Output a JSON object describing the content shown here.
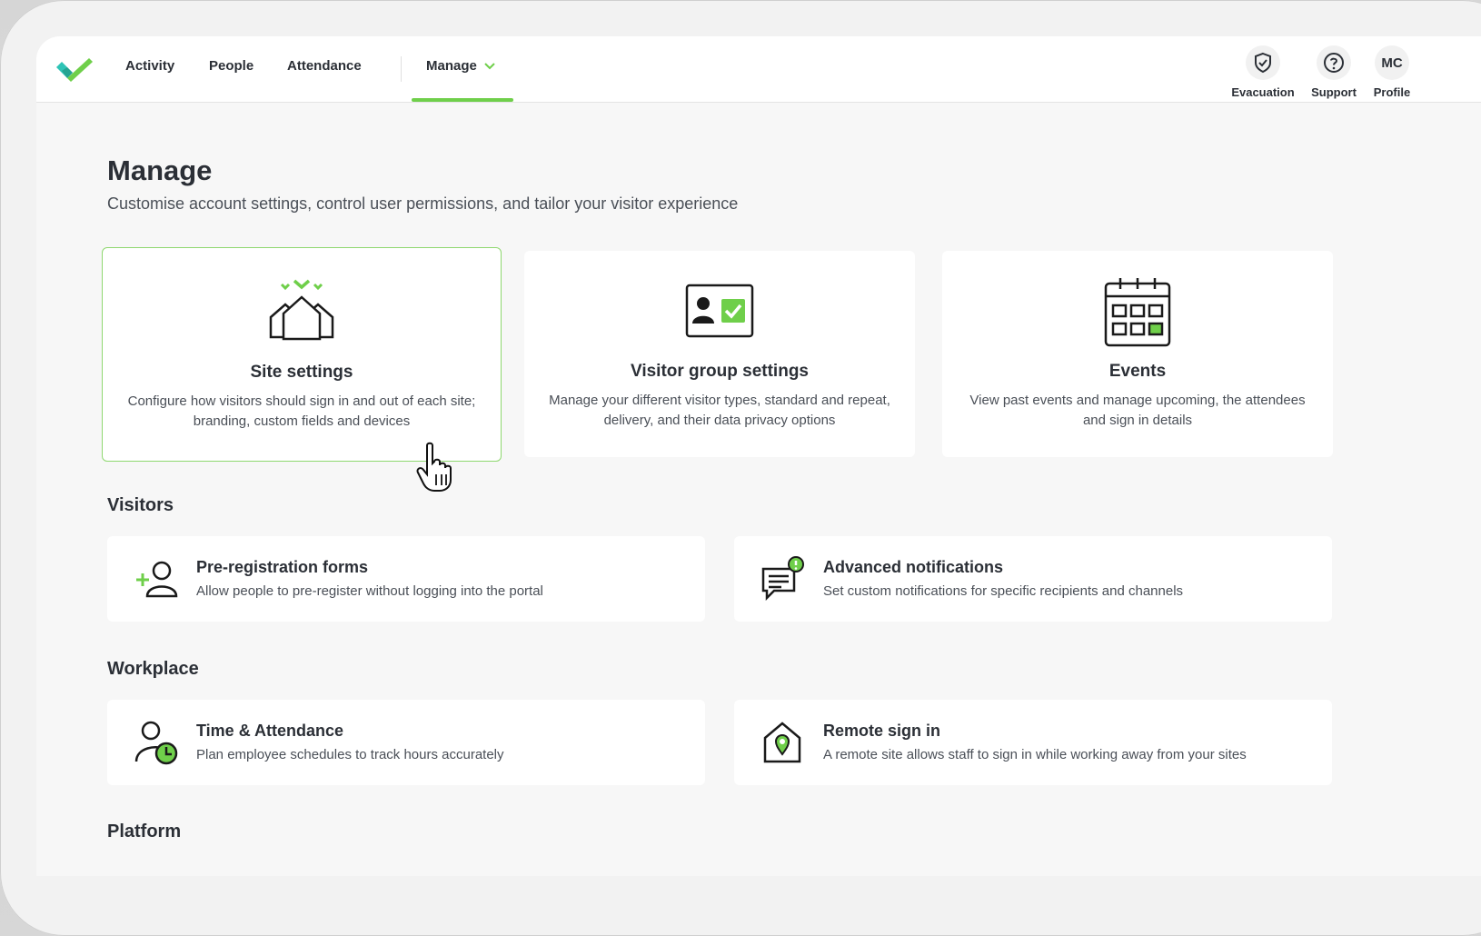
{
  "nav": {
    "items": [
      {
        "label": "Activity"
      },
      {
        "label": "People"
      },
      {
        "label": "Attendance"
      }
    ],
    "manage_label": "Manage"
  },
  "tools": {
    "evacuation": "Evacuation",
    "support": "Support",
    "profile_initials": "MC",
    "profile": "Profile"
  },
  "page": {
    "title": "Manage",
    "subtitle": "Customise account settings, control user permissions, and tailor your visitor experience"
  },
  "cards": [
    {
      "title": "Site settings",
      "desc": "Configure how visitors should sign in and out of each site; branding, custom fields and devices",
      "icon": "houses-icon"
    },
    {
      "title": "Visitor group settings",
      "desc": "Manage your different visitor types, standard and repeat, delivery, and their data privacy options",
      "icon": "id-card-icon"
    },
    {
      "title": "Events",
      "desc": "View past events and manage upcoming, the attendees and sign in details",
      "icon": "calendar-icon"
    }
  ],
  "sections": {
    "visitors": "Visitors",
    "workplace": "Workplace",
    "platform": "Platform"
  },
  "visitors": [
    {
      "title": "Pre-registration forms",
      "desc": "Allow people to pre-register without logging into the portal",
      "icon": "add-person-icon"
    },
    {
      "title": "Advanced notifications",
      "desc": "Set custom notifications for specific recipients and channels",
      "icon": "notification-icon"
    }
  ],
  "workplace": [
    {
      "title": "Time & Attendance",
      "desc": "Plan employee schedules to track hours accurately",
      "icon": "person-clock-icon"
    },
    {
      "title": "Remote sign in",
      "desc": "A remote site allows staff to sign in while working away from your sites",
      "icon": "location-house-icon"
    }
  ],
  "colors": {
    "accent": "#6fcf4a",
    "text": "#2b2f36",
    "muted": "#4a4f57",
    "logo_teal": "#2ec4b6"
  }
}
